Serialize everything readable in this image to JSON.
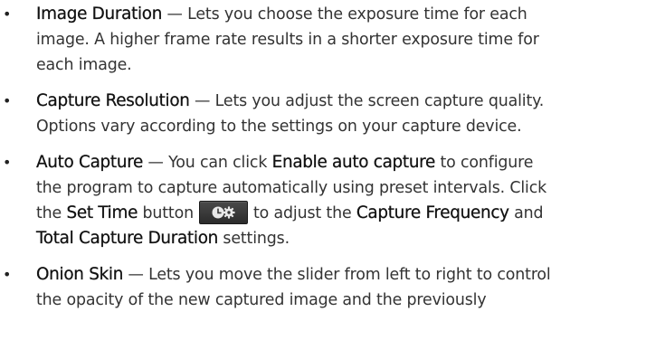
{
  "items": [
    {
      "term": "Image Duration",
      "line1": " — Lets you choose the exposure time for each",
      "line2": "image. A higher frame rate results in a shorter exposure time for",
      "line3": "each image."
    },
    {
      "term": "Capture Resolution",
      "line1": " — Lets you adjust the screen capture quality.",
      "line2": "Options vary according to the settings on your capture device."
    },
    {
      "term": "Auto Capture",
      "line1": " — You can click ",
      "line1_bold": "Enable auto capture",
      "line1_end": " to configure",
      "line2": "the program to capture automatically using preset intervals. Click",
      "line3_a": "the ",
      "line3_bold1": "Set Time",
      "line3_b": " button",
      "line3_c": "to adjust the ",
      "line3_bold2": "Capture Frequency",
      "line3_d": " and",
      "line4_bold": "Total Capture Duration",
      "line4_end": " settings.",
      "icon": "clock-gear-icon"
    },
    {
      "term": "Onion Skin",
      "line1": " — Lets you move the slider from left to right to control",
      "line2": "the opacity of the new captured image and the previously"
    }
  ],
  "bullet": "•"
}
